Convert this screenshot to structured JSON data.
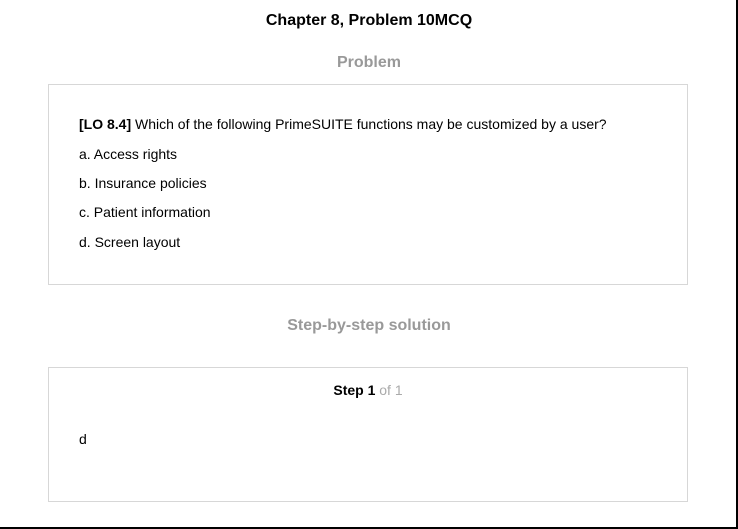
{
  "header": {
    "title": "Chapter 8, Problem 10MCQ"
  },
  "problem": {
    "heading": "Problem",
    "lo_tag": "[LO 8.4]",
    "question": "Which of the following PrimeSUITE functions may be customized by a user?",
    "options": [
      "a. Access rights",
      "b. Insurance policies",
      "c. Patient information",
      "d. Screen layout"
    ]
  },
  "solution": {
    "heading": "Step-by-step solution",
    "step_word": "Step 1",
    "step_of": "of 1",
    "answer": "d"
  },
  "colors": {
    "heading_gray": "#999999",
    "card_border": "#d7d7d7",
    "step_of_gray": "#aaaaaa"
  }
}
